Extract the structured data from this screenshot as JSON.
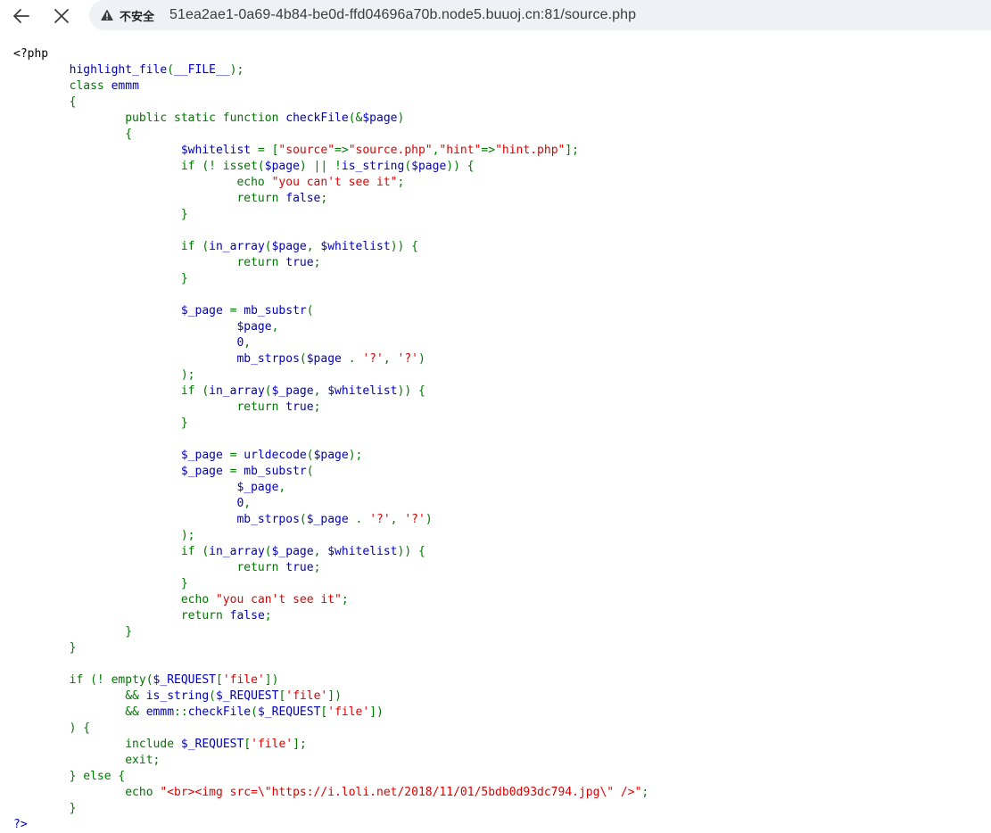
{
  "browser": {
    "back_icon": "arrow-left-icon",
    "stop_icon": "close-icon",
    "security_icon": "warning-triangle-icon",
    "security_label": "不安全",
    "url": "51ea2ae1-0a69-4b84-be0d-ffd04696a70b.node5.buuoj.cn:81/source.php"
  },
  "colors": {
    "default": "#0000BB",
    "keyword": "#007700",
    "string": "#DD0000",
    "html": "#000000"
  },
  "code": {
    "lines": [
      [
        [
          "h",
          "<?php"
        ]
      ],
      [
        [
          "h",
          "        "
        ],
        [
          "d",
          "highlight_file"
        ],
        [
          "k",
          "("
        ],
        [
          "d",
          "__FILE__"
        ],
        [
          "k",
          ");"
        ]
      ],
      [
        [
          "h",
          "        "
        ],
        [
          "k",
          "class "
        ],
        [
          "d",
          "emmm"
        ]
      ],
      [
        [
          "h",
          "        "
        ],
        [
          "k",
          "{"
        ]
      ],
      [
        [
          "h",
          "                "
        ],
        [
          "k",
          "public static function "
        ],
        [
          "d",
          "checkFile"
        ],
        [
          "k",
          "(&"
        ],
        [
          "d",
          "$page"
        ],
        [
          "k",
          ")"
        ]
      ],
      [
        [
          "h",
          "                "
        ],
        [
          "k",
          "{"
        ]
      ],
      [
        [
          "h",
          "                        "
        ],
        [
          "d",
          "$whitelist "
        ],
        [
          "k",
          "= ["
        ],
        [
          "s",
          "\"source\""
        ],
        [
          "k",
          "=>"
        ],
        [
          "s",
          "\"source.php\""
        ],
        [
          "k",
          ","
        ],
        [
          "s",
          "\"hint\""
        ],
        [
          "k",
          "=>"
        ],
        [
          "s",
          "\"hint.php\""
        ],
        [
          "k",
          "];"
        ]
      ],
      [
        [
          "h",
          "                        "
        ],
        [
          "k",
          "if (! isset("
        ],
        [
          "d",
          "$page"
        ],
        [
          "k",
          ") || !"
        ],
        [
          "d",
          "is_string"
        ],
        [
          "k",
          "("
        ],
        [
          "d",
          "$page"
        ],
        [
          "k",
          ")) {"
        ]
      ],
      [
        [
          "h",
          "                                "
        ],
        [
          "k",
          "echo "
        ],
        [
          "s",
          "\"you can't see it\""
        ],
        [
          "k",
          ";"
        ]
      ],
      [
        [
          "h",
          "                                "
        ],
        [
          "k",
          "return "
        ],
        [
          "d",
          "false"
        ],
        [
          "k",
          ";"
        ]
      ],
      [
        [
          "h",
          "                        "
        ],
        [
          "k",
          "}"
        ]
      ],
      [
        [
          "h",
          ""
        ]
      ],
      [
        [
          "h",
          "                        "
        ],
        [
          "k",
          "if ("
        ],
        [
          "d",
          "in_array"
        ],
        [
          "k",
          "("
        ],
        [
          "d",
          "$page"
        ],
        [
          "k",
          ", "
        ],
        [
          "d",
          "$whitelist"
        ],
        [
          "k",
          ")) {"
        ]
      ],
      [
        [
          "h",
          "                                "
        ],
        [
          "k",
          "return "
        ],
        [
          "d",
          "true"
        ],
        [
          "k",
          ";"
        ]
      ],
      [
        [
          "h",
          "                        "
        ],
        [
          "k",
          "}"
        ]
      ],
      [
        [
          "h",
          ""
        ]
      ],
      [
        [
          "h",
          "                        "
        ],
        [
          "d",
          "$_page "
        ],
        [
          "k",
          "= "
        ],
        [
          "d",
          "mb_substr"
        ],
        [
          "k",
          "("
        ]
      ],
      [
        [
          "h",
          "                                "
        ],
        [
          "d",
          "$page"
        ],
        [
          "k",
          ","
        ]
      ],
      [
        [
          "h",
          "                                "
        ],
        [
          "d",
          "0"
        ],
        [
          "k",
          ","
        ]
      ],
      [
        [
          "h",
          "                                "
        ],
        [
          "d",
          "mb_strpos"
        ],
        [
          "k",
          "("
        ],
        [
          "d",
          "$page "
        ],
        [
          "k",
          ". "
        ],
        [
          "s",
          "'?'"
        ],
        [
          "k",
          ", "
        ],
        [
          "s",
          "'?'"
        ],
        [
          "k",
          ")"
        ]
      ],
      [
        [
          "h",
          "                        "
        ],
        [
          "k",
          ");"
        ]
      ],
      [
        [
          "h",
          "                        "
        ],
        [
          "k",
          "if ("
        ],
        [
          "d",
          "in_array"
        ],
        [
          "k",
          "("
        ],
        [
          "d",
          "$_page"
        ],
        [
          "k",
          ", "
        ],
        [
          "d",
          "$whitelist"
        ],
        [
          "k",
          ")) {"
        ]
      ],
      [
        [
          "h",
          "                                "
        ],
        [
          "k",
          "return "
        ],
        [
          "d",
          "true"
        ],
        [
          "k",
          ";"
        ]
      ],
      [
        [
          "h",
          "                        "
        ],
        [
          "k",
          "}"
        ]
      ],
      [
        [
          "h",
          ""
        ]
      ],
      [
        [
          "h",
          "                        "
        ],
        [
          "d",
          "$_page "
        ],
        [
          "k",
          "= "
        ],
        [
          "d",
          "urldecode"
        ],
        [
          "k",
          "("
        ],
        [
          "d",
          "$page"
        ],
        [
          "k",
          ");"
        ]
      ],
      [
        [
          "h",
          "                        "
        ],
        [
          "d",
          "$_page "
        ],
        [
          "k",
          "= "
        ],
        [
          "d",
          "mb_substr"
        ],
        [
          "k",
          "("
        ]
      ],
      [
        [
          "h",
          "                                "
        ],
        [
          "d",
          "$_page"
        ],
        [
          "k",
          ","
        ]
      ],
      [
        [
          "h",
          "                                "
        ],
        [
          "d",
          "0"
        ],
        [
          "k",
          ","
        ]
      ],
      [
        [
          "h",
          "                                "
        ],
        [
          "d",
          "mb_strpos"
        ],
        [
          "k",
          "("
        ],
        [
          "d",
          "$_page "
        ],
        [
          "k",
          ". "
        ],
        [
          "s",
          "'?'"
        ],
        [
          "k",
          ", "
        ],
        [
          "s",
          "'?'"
        ],
        [
          "k",
          ")"
        ]
      ],
      [
        [
          "h",
          "                        "
        ],
        [
          "k",
          ");"
        ]
      ],
      [
        [
          "h",
          "                        "
        ],
        [
          "k",
          "if ("
        ],
        [
          "d",
          "in_array"
        ],
        [
          "k",
          "("
        ],
        [
          "d",
          "$_page"
        ],
        [
          "k",
          ", "
        ],
        [
          "d",
          "$whitelist"
        ],
        [
          "k",
          ")) {"
        ]
      ],
      [
        [
          "h",
          "                                "
        ],
        [
          "k",
          "return "
        ],
        [
          "d",
          "true"
        ],
        [
          "k",
          ";"
        ]
      ],
      [
        [
          "h",
          "                        "
        ],
        [
          "k",
          "}"
        ]
      ],
      [
        [
          "h",
          "                        "
        ],
        [
          "k",
          "echo "
        ],
        [
          "s",
          "\"you can't see it\""
        ],
        [
          "k",
          ";"
        ]
      ],
      [
        [
          "h",
          "                        "
        ],
        [
          "k",
          "return "
        ],
        [
          "d",
          "false"
        ],
        [
          "k",
          ";"
        ]
      ],
      [
        [
          "h",
          "                "
        ],
        [
          "k",
          "}"
        ]
      ],
      [
        [
          "h",
          "        "
        ],
        [
          "k",
          "}"
        ]
      ],
      [
        [
          "h",
          ""
        ]
      ],
      [
        [
          "h",
          "        "
        ],
        [
          "k",
          "if (! empty("
        ],
        [
          "d",
          "$_REQUEST"
        ],
        [
          "k",
          "["
        ],
        [
          "s",
          "'file'"
        ],
        [
          "k",
          "])"
        ]
      ],
      [
        [
          "h",
          "                "
        ],
        [
          "k",
          "&& "
        ],
        [
          "d",
          "is_string"
        ],
        [
          "k",
          "("
        ],
        [
          "d",
          "$_REQUEST"
        ],
        [
          "k",
          "["
        ],
        [
          "s",
          "'file'"
        ],
        [
          "k",
          "])"
        ]
      ],
      [
        [
          "h",
          "                "
        ],
        [
          "k",
          "&& "
        ],
        [
          "d",
          "emmm"
        ],
        [
          "k",
          "::"
        ],
        [
          "d",
          "checkFile"
        ],
        [
          "k",
          "("
        ],
        [
          "d",
          "$_REQUEST"
        ],
        [
          "k",
          "["
        ],
        [
          "s",
          "'file'"
        ],
        [
          "k",
          "])"
        ]
      ],
      [
        [
          "h",
          "        "
        ],
        [
          "k",
          ") {"
        ]
      ],
      [
        [
          "h",
          "                "
        ],
        [
          "k",
          "include "
        ],
        [
          "d",
          "$_REQUEST"
        ],
        [
          "k",
          "["
        ],
        [
          "s",
          "'file'"
        ],
        [
          "k",
          "];"
        ]
      ],
      [
        [
          "h",
          "                "
        ],
        [
          "k",
          "exit;"
        ]
      ],
      [
        [
          "h",
          "        "
        ],
        [
          "k",
          "} else {"
        ]
      ],
      [
        [
          "h",
          "                "
        ],
        [
          "k",
          "echo "
        ],
        [
          "s",
          "\"<br><img src=\\\"https://i.loli.net/2018/11/01/5bdb0d93dc794.jpg\\\" />\""
        ],
        [
          "k",
          ";"
        ]
      ],
      [
        [
          "h",
          "        "
        ],
        [
          "k",
          "}"
        ]
      ],
      [
        [
          "d",
          "?>"
        ]
      ]
    ]
  }
}
